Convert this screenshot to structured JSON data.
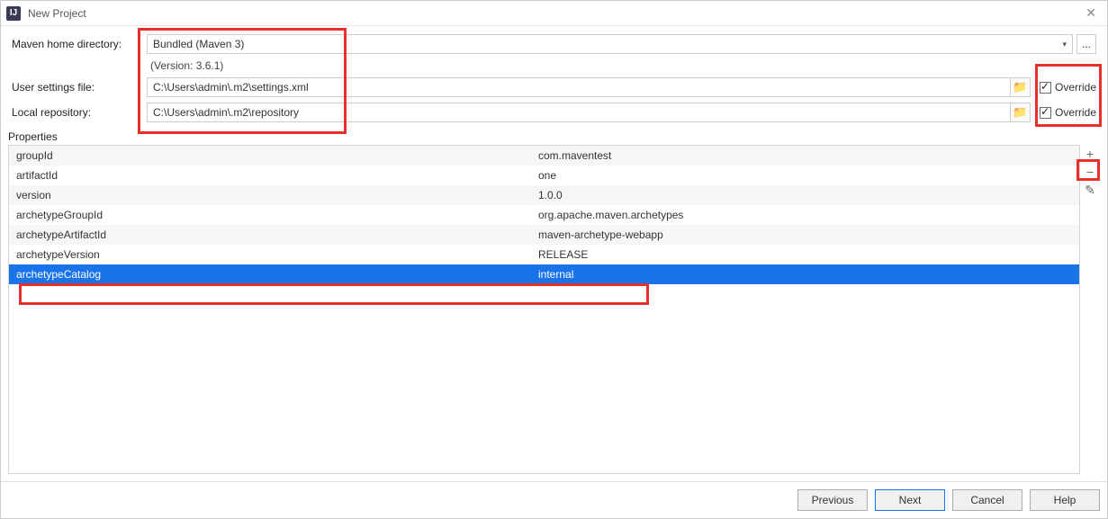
{
  "titlebar": {
    "title": "New Project"
  },
  "labels": {
    "maven_home": "Maven home directory:",
    "user_settings": "User settings file:",
    "local_repo": "Local repository:",
    "properties": "Properties",
    "override": "Override"
  },
  "maven": {
    "bundled": "Bundled (Maven 3)",
    "version_note": "(Version: 3.6.1)",
    "dots": "..."
  },
  "paths": {
    "settings": "C:\\Users\\admin\\.m2\\settings.xml",
    "repo": "C:\\Users\\admin\\.m2\\repository"
  },
  "properties_rows": [
    {
      "key": "groupId",
      "value": "com.maventest"
    },
    {
      "key": "artifactId",
      "value": "one"
    },
    {
      "key": "version",
      "value": "1.0.0"
    },
    {
      "key": "archetypeGroupId",
      "value": "org.apache.maven.archetypes"
    },
    {
      "key": "archetypeArtifactId",
      "value": "maven-archetype-webapp"
    },
    {
      "key": "archetypeVersion",
      "value": "RELEASE"
    },
    {
      "key": "archetypeCatalog",
      "value": "internal"
    }
  ],
  "tools": {
    "add": "+",
    "remove": "−",
    "edit": "✎"
  },
  "buttons": {
    "previous": "Previous",
    "next": "Next",
    "cancel": "Cancel",
    "help": "Help"
  },
  "icons": {
    "folder": "📁",
    "close": "✕",
    "logo": "IJ",
    "dropdown": "▾"
  }
}
